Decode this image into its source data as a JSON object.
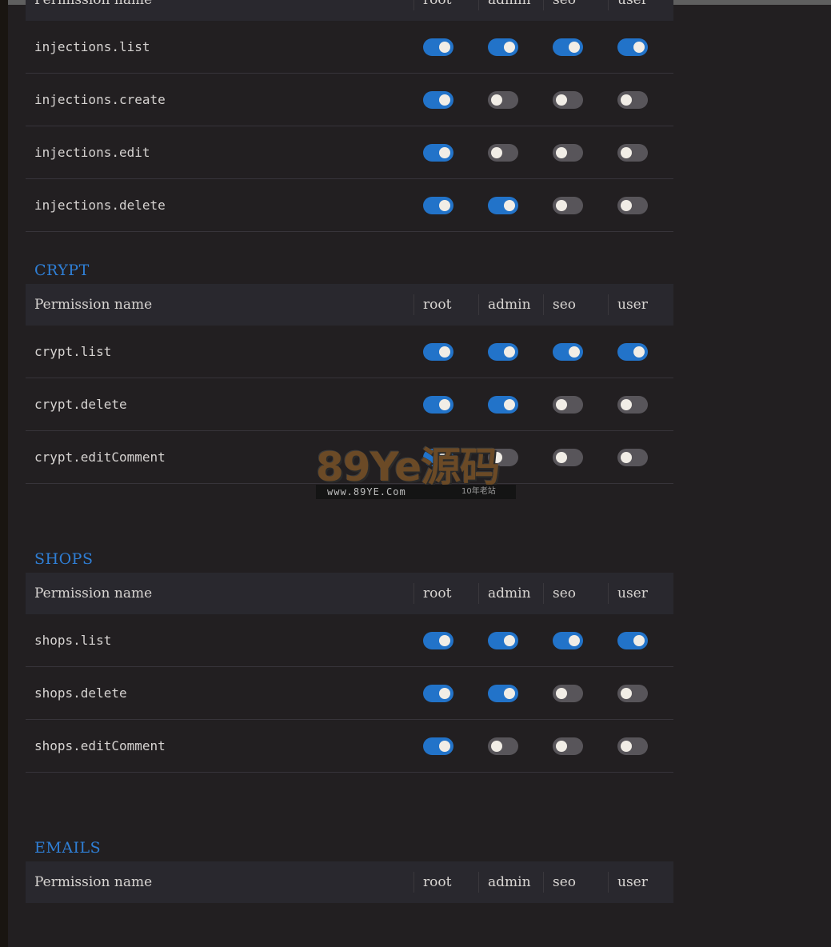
{
  "columns": {
    "name": "Permission name",
    "roles": [
      "root",
      "admin",
      "seo",
      "user"
    ]
  },
  "sections": [
    {
      "title": "",
      "rows": [
        {
          "name": "injections.list",
          "values": [
            true,
            true,
            true,
            true
          ]
        },
        {
          "name": "injections.create",
          "values": [
            true,
            false,
            false,
            false
          ]
        },
        {
          "name": "injections.edit",
          "values": [
            true,
            false,
            false,
            false
          ]
        },
        {
          "name": "injections.delete",
          "values": [
            true,
            true,
            false,
            false
          ]
        }
      ]
    },
    {
      "title": "CRYPT",
      "rows": [
        {
          "name": "crypt.list",
          "values": [
            true,
            true,
            true,
            true
          ]
        },
        {
          "name": "crypt.delete",
          "values": [
            true,
            true,
            false,
            false
          ]
        },
        {
          "name": "crypt.editComment",
          "values": [
            true,
            false,
            false,
            false
          ]
        }
      ]
    },
    {
      "title": "SHOPS",
      "rows": [
        {
          "name": "shops.list",
          "values": [
            true,
            true,
            true,
            true
          ]
        },
        {
          "name": "shops.delete",
          "values": [
            true,
            true,
            false,
            false
          ]
        },
        {
          "name": "shops.editComment",
          "values": [
            true,
            false,
            false,
            false
          ]
        }
      ]
    },
    {
      "title": "EMAILS",
      "rows": []
    }
  ],
  "watermark": {
    "big": "89Ye源码",
    "url": "www.89YE.Com",
    "tag": "10年老站"
  },
  "colors": {
    "accent": "#2f7fd6",
    "toggle_on": "#2273c9",
    "toggle_off": "#58555a",
    "background": "#221f21",
    "header_bg": "#29282e"
  }
}
